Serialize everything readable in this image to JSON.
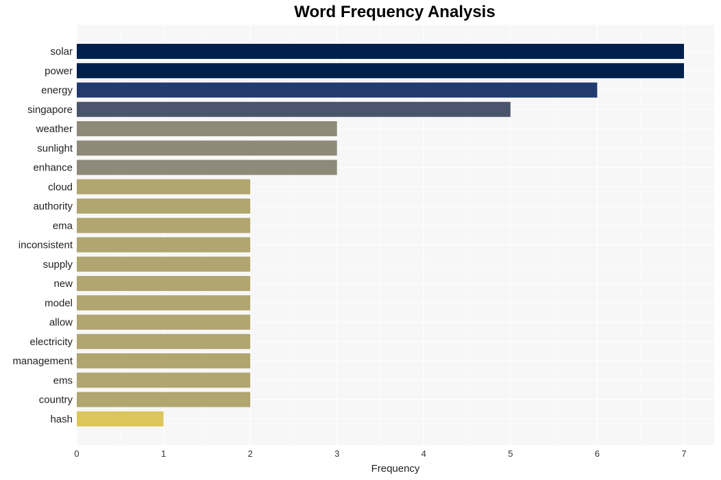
{
  "chart_data": {
    "type": "bar",
    "orientation": "horizontal",
    "title": "Word Frequency Analysis",
    "xlabel": "Frequency",
    "ylabel": "",
    "xlim": [
      0,
      7.35
    ],
    "xticks": [
      0,
      1,
      2,
      3,
      4,
      5,
      6,
      7
    ],
    "grid": true,
    "categories": [
      "solar",
      "power",
      "energy",
      "singapore",
      "weather",
      "sunlight",
      "enhance",
      "cloud",
      "authority",
      "ema",
      "inconsistent",
      "supply",
      "new",
      "model",
      "allow",
      "electricity",
      "management",
      "ems",
      "country",
      "hash"
    ],
    "values": [
      7,
      7,
      6,
      5,
      3,
      3,
      3,
      2,
      2,
      2,
      2,
      2,
      2,
      2,
      2,
      2,
      2,
      2,
      2,
      1
    ],
    "colors": [
      "#00204c",
      "#00204c",
      "#213b6e",
      "#4a546d",
      "#8e8a79",
      "#8e8a79",
      "#8e8a79",
      "#b1a570",
      "#b1a570",
      "#b1a570",
      "#b1a570",
      "#b1a570",
      "#b1a570",
      "#b1a570",
      "#b1a570",
      "#b1a570",
      "#b1a570",
      "#b1a570",
      "#b1a570",
      "#dbc65b"
    ]
  },
  "colors": {
    "plot_background": "#f7f7f7",
    "grid": "#ffffff"
  }
}
